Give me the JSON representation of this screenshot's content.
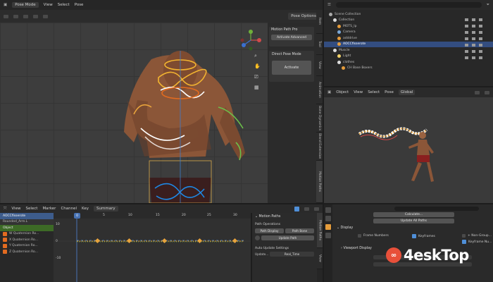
{
  "topbar": {
    "mode": "Pose Mode",
    "menus": [
      "View",
      "Select",
      "Pose"
    ],
    "pose_options": "Pose Options"
  },
  "viewport": {
    "side_tabs": [
      "Item",
      "Tool",
      "View",
      "Animation",
      "Bone Dynamics",
      "Blend Extension",
      "Motion Paths"
    ],
    "panel_title": "Motion Path Pro",
    "activate_advanced": "Activate Advanced",
    "direct_pose_mode": "Direct Pose Mode",
    "activate": "Activate"
  },
  "outliner": {
    "items": [
      {
        "label": "Scene Collection",
        "indent": 0
      },
      {
        "label": "Collection",
        "indent": 1
      },
      {
        "label": "MOTS_Ip",
        "indent": 2
      },
      {
        "label": "Camera",
        "indent": 2
      },
      {
        "label": "adddrive",
        "indent": 2
      },
      {
        "label": "AOCCfisserote",
        "indent": 2,
        "selected": true
      },
      {
        "label": "Muscle",
        "indent": 1
      },
      {
        "label": "Light",
        "indent": 2
      },
      {
        "label": "clothes",
        "indent": 2
      },
      {
        "label": "CH Base Boxers",
        "indent": 3
      }
    ]
  },
  "preview": {
    "menus": [
      "Object",
      "View",
      "Select",
      "Pose"
    ],
    "shading": "Global"
  },
  "properties": {
    "calculate": "Calculate...",
    "update_all": "Update All Paths",
    "display_section": "Display",
    "frame_numbers": "Frame Numbers",
    "keyframes": "Keyframes",
    "plus_non_grouped": "+ Non-Group...",
    "keyframe_numbers": "Keyframe Nu...",
    "viewport_display": "Viewport Display"
  },
  "timeline": {
    "menus": [
      "View",
      "Select",
      "Marker",
      "Channel",
      "Key"
    ],
    "summary": "Summary",
    "channels": [
      {
        "label": "AOCCfisserote",
        "color": "#4a7fbf"
      },
      {
        "label": "Rounded_Arm.L",
        "color": "#3f3f3f"
      },
      {
        "label": "Object",
        "color": "#4f8f2f"
      },
      {
        "label": "W Quaternion Ro...",
        "color": "#333"
      },
      {
        "label": "X Quaternion Ro...",
        "color": "#333"
      },
      {
        "label": "Y Quaternion Ro...",
        "color": "#333"
      },
      {
        "label": "Z Quaternion Ro...",
        "color": "#333"
      }
    ],
    "frame_labels": [
      "0",
      "5",
      "10",
      "15",
      "20",
      "25",
      "30"
    ],
    "value_labels": [
      "10",
      "0",
      "-10"
    ],
    "current_frame": "0"
  },
  "motion_panel": {
    "tabs": [
      "Motion Paths",
      "View"
    ],
    "title": "Motion Paths",
    "path_operations": "Path Operations",
    "path_display": "Path Display",
    "path_bone": "Path Bone",
    "update_path": "Update Path",
    "auto_update_settings": "Auto Update Settings",
    "update_label": "Update...",
    "update_value": "Real_Time"
  },
  "colors": {
    "accent": "#4772b3",
    "active_tab": "#2f5c99",
    "keyframe": "#e8a33c"
  },
  "watermark": {
    "brand": "4eskTop"
  }
}
